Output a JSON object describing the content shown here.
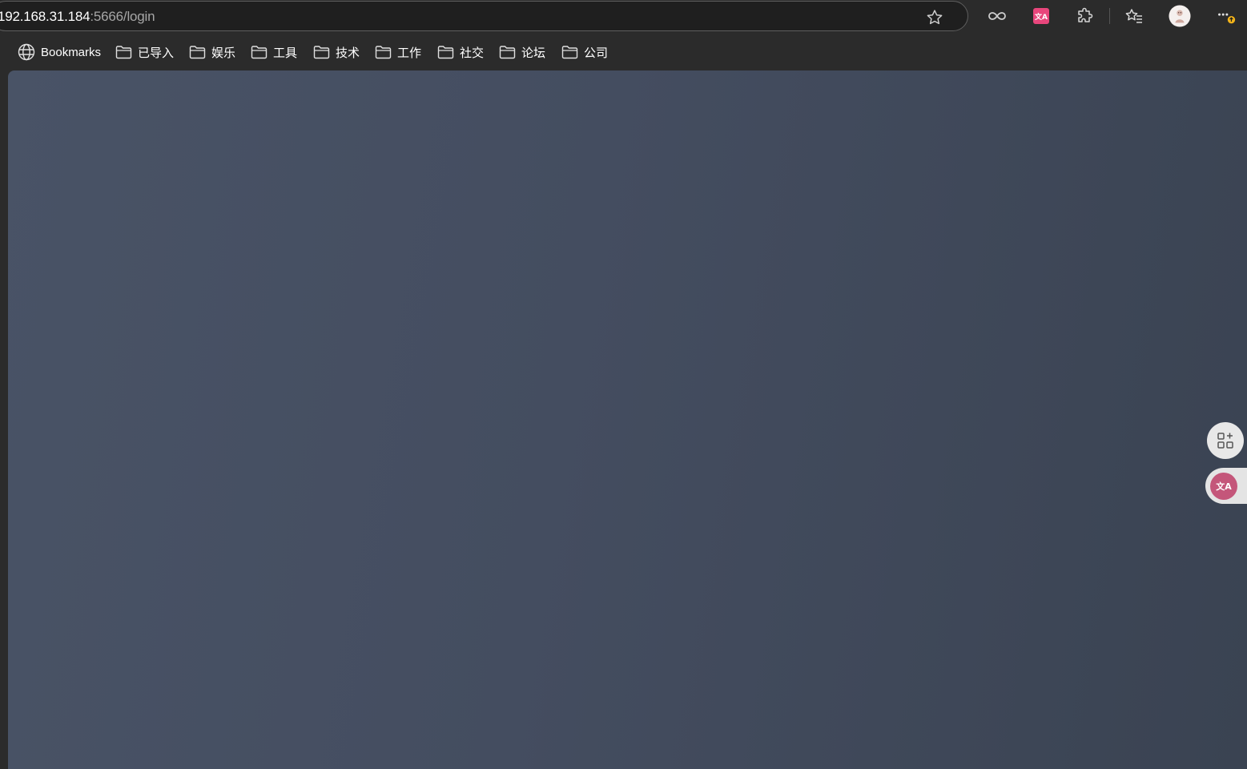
{
  "address_bar": {
    "host": "192.168.31.184",
    "path": ":5666/login"
  },
  "toolbar": {
    "icons": [
      "star-icon",
      "infinity-icon",
      "translate-extension-icon",
      "extensions-puzzle-icon",
      "favorites-icon",
      "profile-avatar",
      "more-menu-icon"
    ],
    "translate_glyph": "文A"
  },
  "bookmarks_bar": {
    "root_label": "Bookmarks",
    "folders": [
      "已导入",
      "娱乐",
      "工具",
      "技术",
      "工作",
      "社交",
      "论坛",
      "公司"
    ]
  },
  "side_panel": {
    "translate_glyph": "文A"
  },
  "colors": {
    "chrome_bg": "#2b2b2b",
    "content_gradient_start": "#495366",
    "content_gradient_end": "#3a4352",
    "translate_accent": "#e8467c",
    "update_badge": "#f2b31a"
  }
}
